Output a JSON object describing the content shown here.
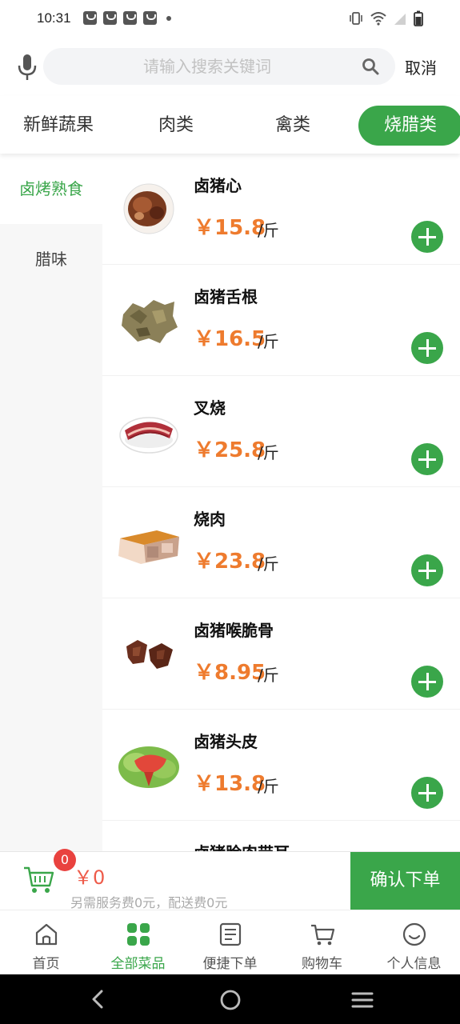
{
  "status_bar": {
    "time": "10:31"
  },
  "search": {
    "placeholder": "请输入搜索关键词",
    "cancel_label": "取消"
  },
  "tabs": [
    {
      "label": "新鲜蔬果"
    },
    {
      "label": "肉类"
    },
    {
      "label": "禽类"
    },
    {
      "label": "烧腊类",
      "active": true
    }
  ],
  "side_menu": [
    {
      "label": "卤烤熟食",
      "active": true
    },
    {
      "label": "腊味"
    }
  ],
  "products": [
    {
      "name": "卤猪心",
      "price": "￥15.8",
      "unit": "/斤"
    },
    {
      "name": "卤猪舌根",
      "price": "￥16.5",
      "unit": "/斤"
    },
    {
      "name": "叉烧",
      "price": "￥25.8",
      "unit": "/斤"
    },
    {
      "name": "烧肉",
      "price": "￥23.8",
      "unit": "/斤"
    },
    {
      "name": "卤猪喉脆骨",
      "price": "￥8.95",
      "unit": "/斤"
    },
    {
      "name": "卤猪头皮",
      "price": "￥13.8",
      "unit": "/斤"
    },
    {
      "name": "卤猪脸肉带耳",
      "price": "",
      "unit": ""
    }
  ],
  "cart": {
    "count": "0",
    "total": "￥0",
    "note": "另需服务费0元，配送费0元",
    "confirm_label": "确认下单"
  },
  "bottom_nav": [
    {
      "label": "首页",
      "icon": "home-icon"
    },
    {
      "label": "全部菜品",
      "icon": "grid-icon",
      "active": true
    },
    {
      "label": "便捷下单",
      "icon": "order-icon"
    },
    {
      "label": "购物车",
      "icon": "cart-icon"
    },
    {
      "label": "个人信息",
      "icon": "profile-icon"
    }
  ],
  "colors": {
    "accent": "#3aa64a",
    "price": "#ee7b2e",
    "badge": "#e9423f"
  }
}
